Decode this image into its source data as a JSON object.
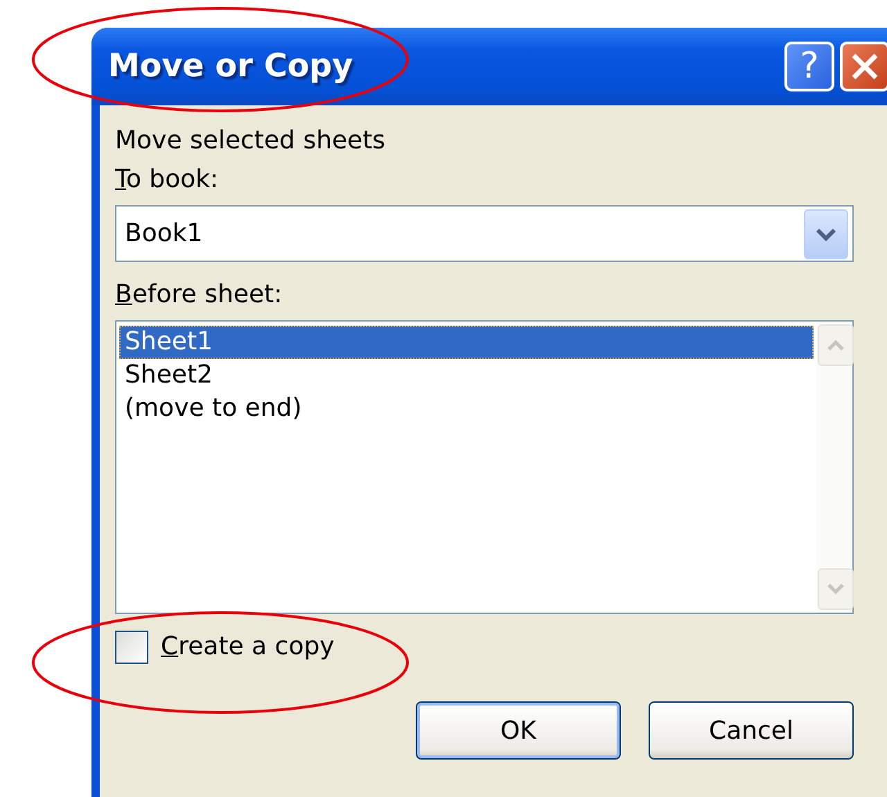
{
  "window": {
    "title": "Move or Copy"
  },
  "title_buttons": [
    {
      "kind": "help",
      "label": "?"
    },
    {
      "kind": "close"
    }
  ],
  "heading": "Move selected sheets",
  "to_book": {
    "label": "To book:",
    "first_letter_underlined": true,
    "value": "Book1"
  },
  "before_sheet": {
    "label": "Before sheet:",
    "first_letter_underlined": true,
    "items": [
      {
        "label": "Sheet1",
        "selected": true
      },
      {
        "label": "Sheet2",
        "selected": false
      },
      {
        "label": "(move to end)",
        "selected": false
      }
    ]
  },
  "create_copy": {
    "label": "Create a copy",
    "first_letter_underlined": true,
    "checked": false
  },
  "buttons": [
    {
      "label": "OK",
      "default": true
    },
    {
      "label": "Cancel",
      "default": false
    }
  ]
}
